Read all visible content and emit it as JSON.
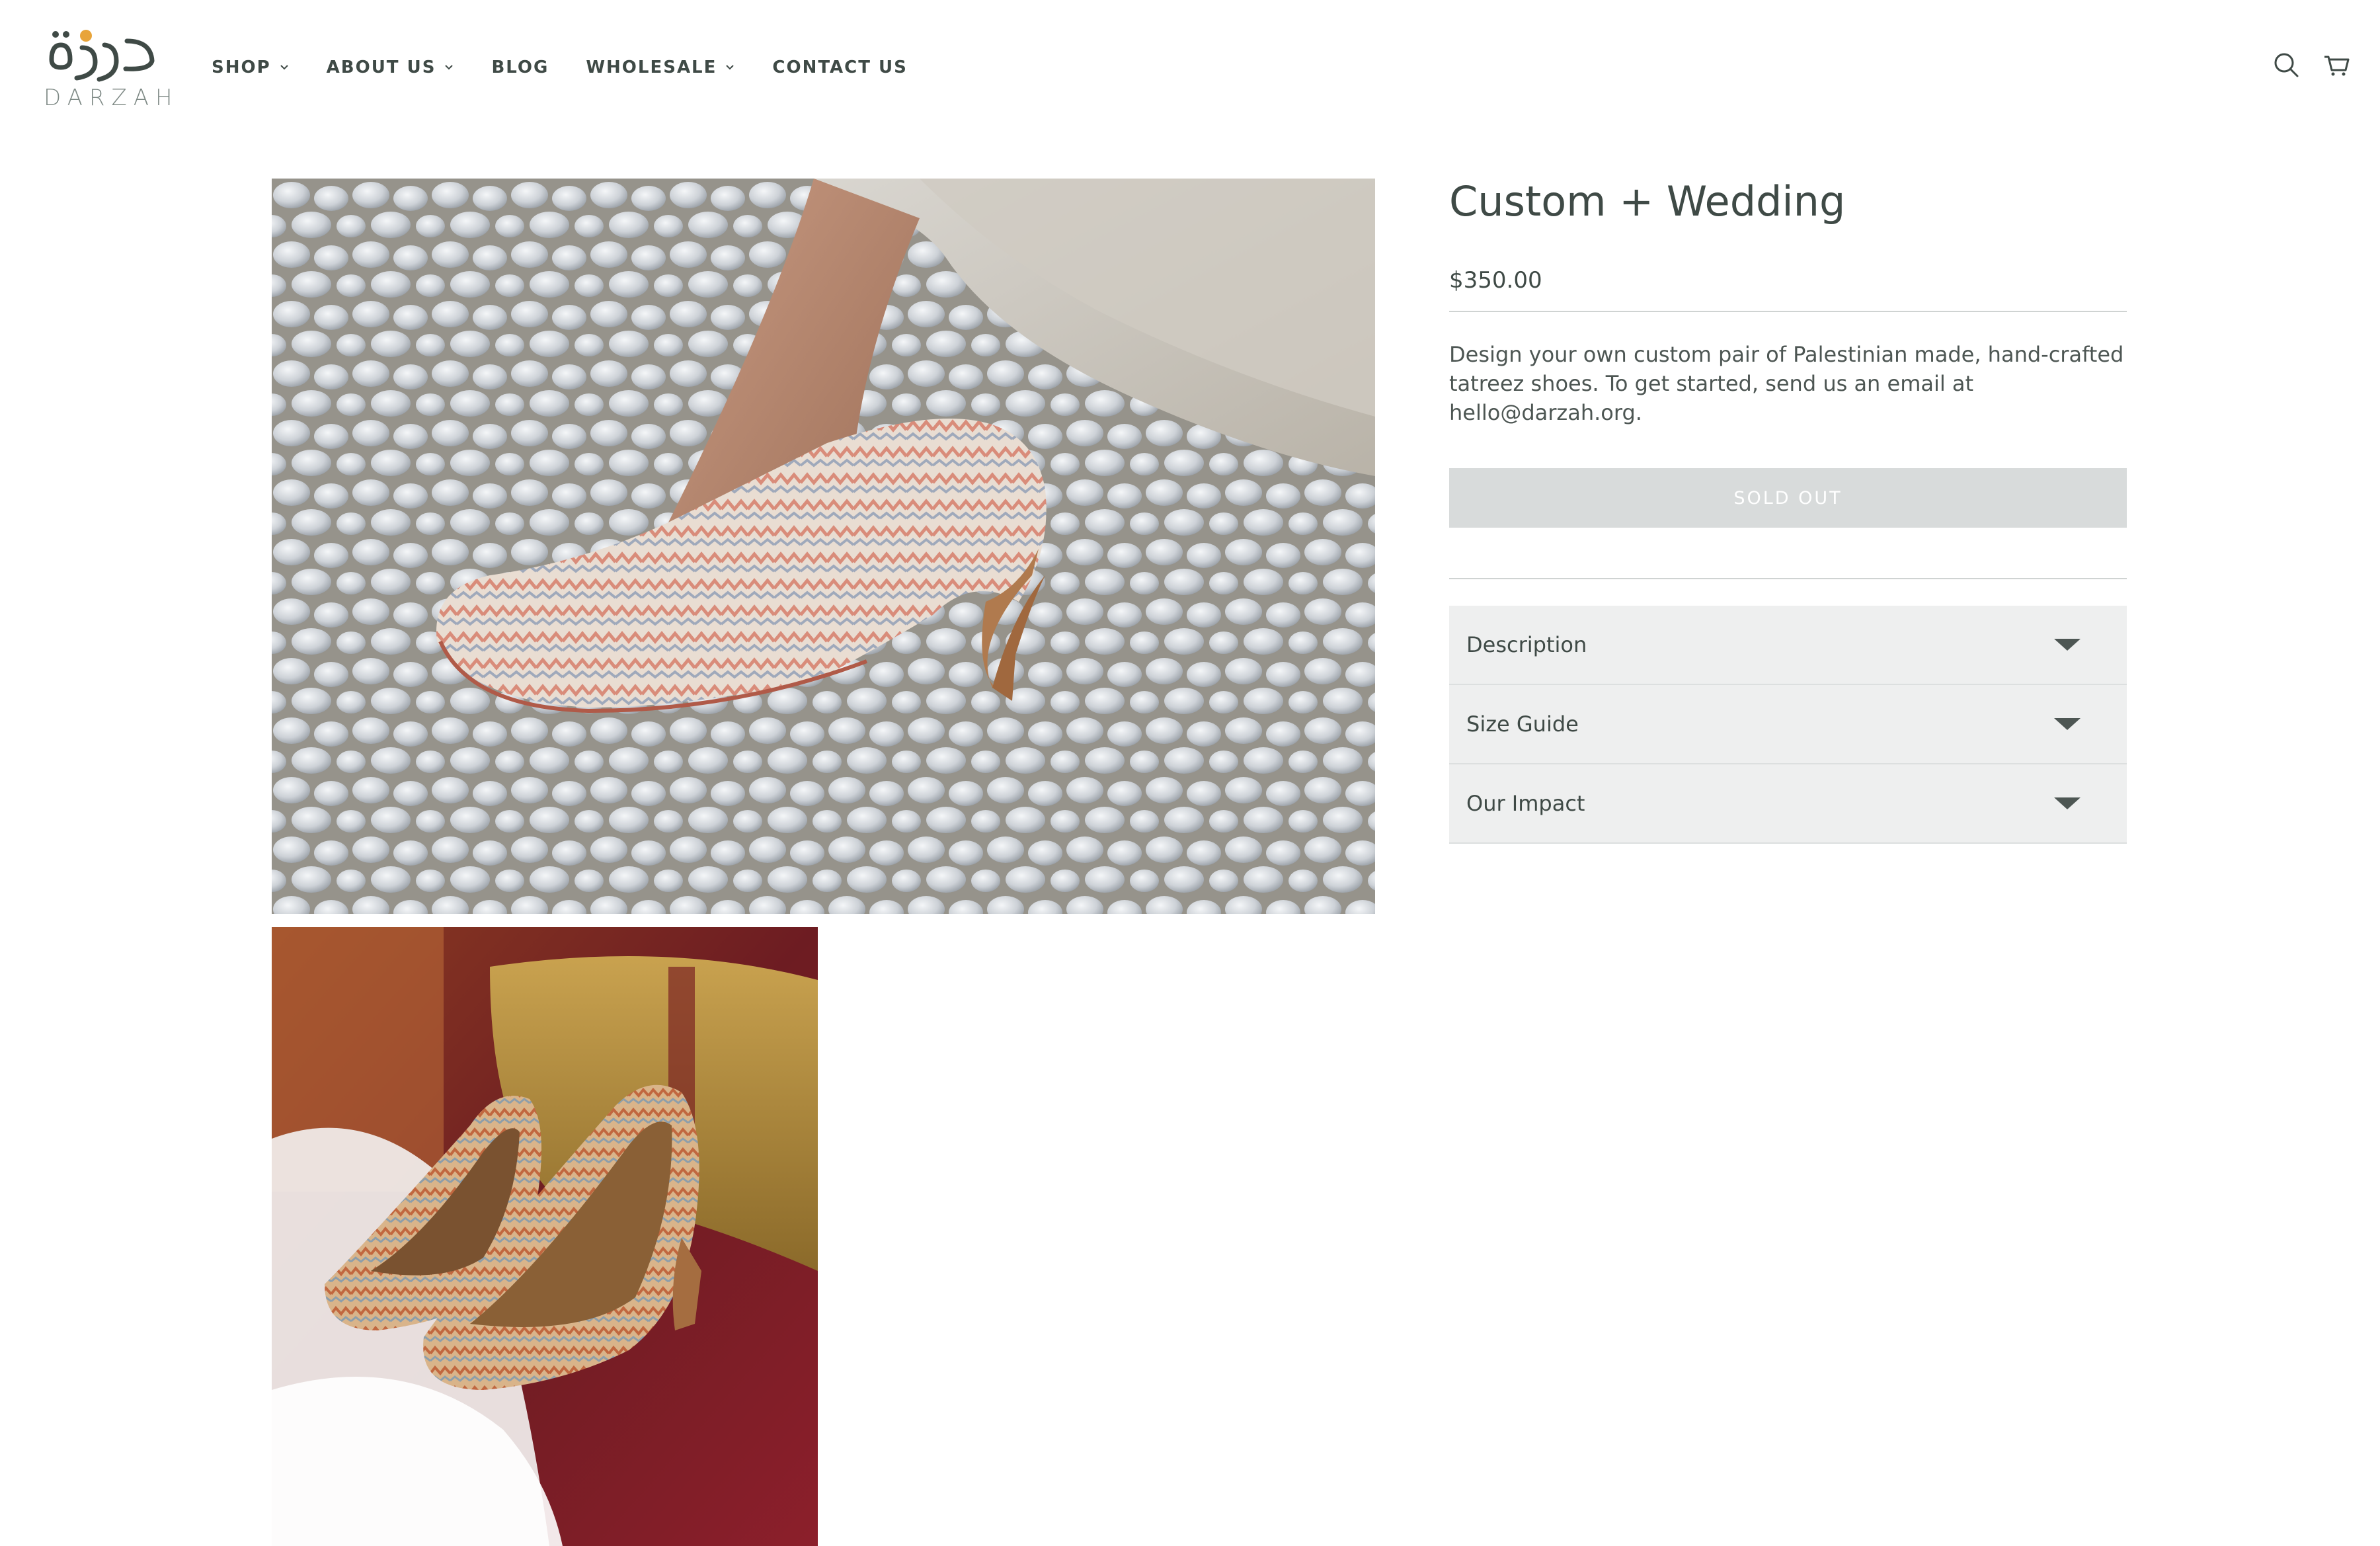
{
  "brand": {
    "arabic_name": "درزة",
    "latin_name": "DARZAH"
  },
  "nav": {
    "items": [
      {
        "label": "SHOP",
        "has_dropdown": true
      },
      {
        "label": "ABOUT US",
        "has_dropdown": true
      },
      {
        "label": "BLOG",
        "has_dropdown": false
      },
      {
        "label": "WHOLESALE",
        "has_dropdown": true
      },
      {
        "label": "CONTACT US",
        "has_dropdown": false
      }
    ]
  },
  "header_icons": [
    "search-icon",
    "cart-icon"
  ],
  "product": {
    "title": "Custom + Wedding",
    "price": "$350.00",
    "description": "Design your own custom pair of Palestinian made, hand-crafted tatreez shoes. To get started, send us an email at hello@darzah.org.",
    "button_label": "SOLD OUT"
  },
  "accordion": [
    {
      "label": "Description"
    },
    {
      "label": "Size Guide"
    },
    {
      "label": "Our Impact"
    }
  ],
  "colors": {
    "text": "#3f4a46",
    "sold_out_bg": "#d8dbdb",
    "accordion_bg": "#eeefef",
    "logo_accent": "#e8a43a"
  }
}
